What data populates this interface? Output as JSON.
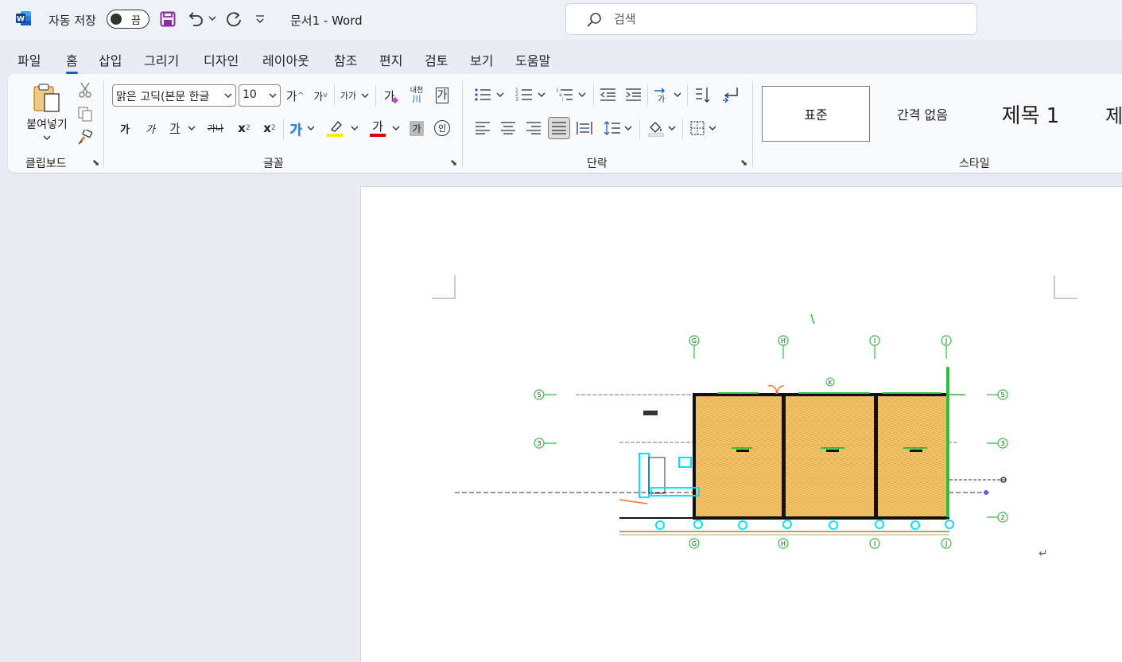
{
  "titlebar": {
    "autosave_label": "자동 저장",
    "autosave_state": "끔",
    "doc_title": "문서1  -  Word",
    "search_placeholder": "검색"
  },
  "menu": {
    "tabs": [
      "파일",
      "홈",
      "삽입",
      "그리기",
      "디자인",
      "레이아웃",
      "참조",
      "편지",
      "검토",
      "보기",
      "도움말"
    ],
    "active": "홈"
  },
  "ribbon": {
    "clipboard": {
      "paste_label": "붙여넣기",
      "group_label": "클립보드"
    },
    "font": {
      "font_name": "맑은 고딕(본문 한글",
      "font_size": "10",
      "group_label": "글꼴",
      "bold": "가",
      "italic": "가",
      "underline": "가",
      "strike": "가나",
      "subscript": "x",
      "superscript": "x",
      "effects": "가",
      "highlight_glyph": "가",
      "fontcolor_glyph": "가",
      "shading_glyph": "가",
      "enclose_glyph": "인",
      "grow": "가",
      "shrink": "가",
      "changecase": "가가",
      "clear_glyph": "가",
      "phonetic": "내천",
      "phonetic_sub": "川",
      "charborder": "가"
    },
    "paragraph": {
      "group_label": "단락"
    },
    "styles": {
      "group_label": "스타일",
      "items": [
        "표준",
        "간격 없음",
        "제목 1",
        "제"
      ]
    }
  },
  "colors": {
    "accent": "#185abd",
    "highlight": "#ffeb00",
    "fontcolor": "#e00000",
    "cad_green": "#2bbf3a",
    "cad_hatch": "#e8b04a",
    "cad_cyan": "#00e5ff"
  },
  "icons": {
    "app": "word-logo-icon",
    "save": "save-icon",
    "undo": "undo-icon",
    "redo": "redo-icon",
    "customize": "customize-qat-icon",
    "search": "search-icon",
    "paste": "paste-icon",
    "cut": "cut-icon",
    "copy": "copy-icon",
    "format_painter": "format-painter-icon"
  },
  "document": {
    "grid_labels_top": [
      "G",
      "H",
      "I",
      "J"
    ],
    "grid_labels_bottom": [
      "G",
      "H",
      "I",
      "J"
    ],
    "row_labels_left": [
      "5",
      "3"
    ],
    "row_labels_right": [
      "5",
      "3",
      "2"
    ],
    "small_label": "K",
    "paragraph_mark": "↵"
  }
}
